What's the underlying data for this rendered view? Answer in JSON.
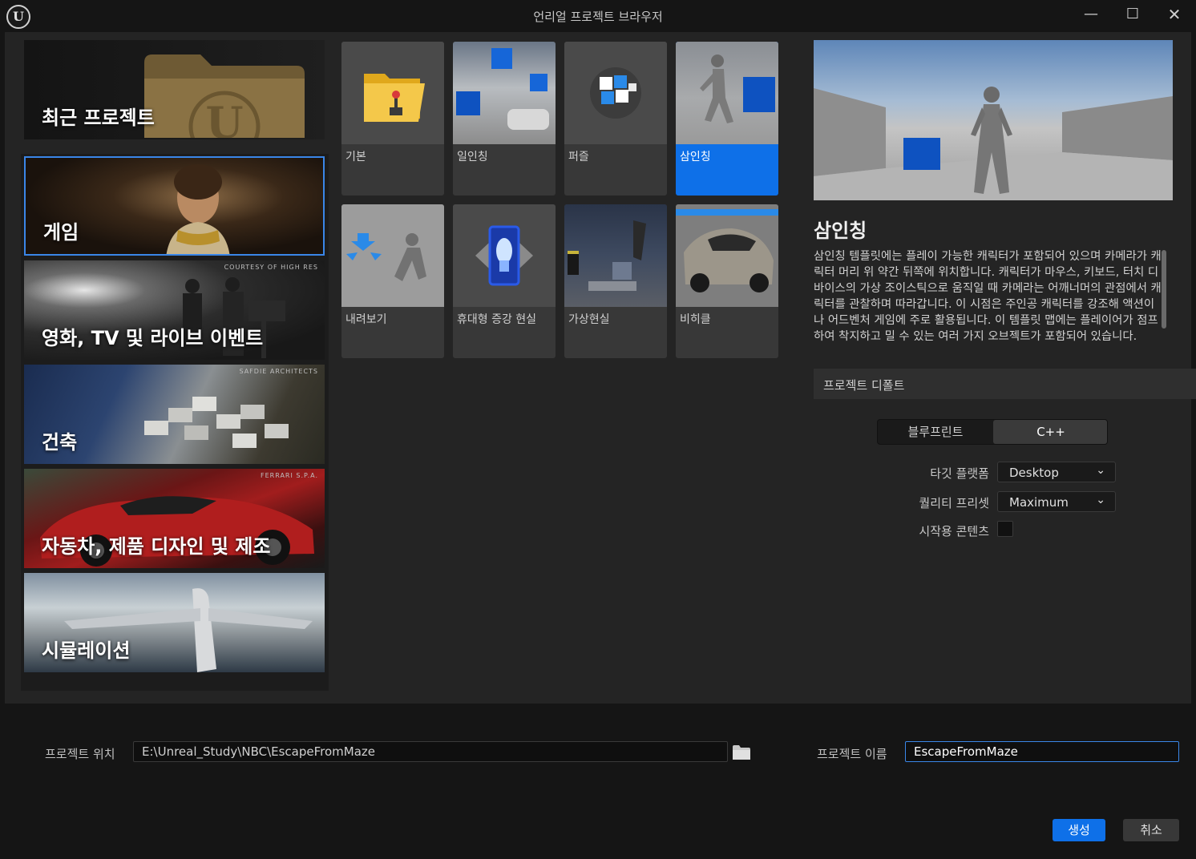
{
  "window": {
    "title": "언리얼 프로젝트 브라우저",
    "logo_text": "U",
    "minimize": "—",
    "maximize": "☐",
    "close": "✕"
  },
  "categories": [
    {
      "label": "최근 프로젝트",
      "credit": ""
    },
    {
      "label": "게임",
      "credit": ""
    },
    {
      "label": "영화, TV 및 라이브 이벤트",
      "credit": "COURTESY OF HIGH RES"
    },
    {
      "label": "건축",
      "credit": "SAFDIE ARCHITECTS"
    },
    {
      "label": "자동차, 제품 디자인 및 제조",
      "credit": "FERRARI S.P.A."
    },
    {
      "label": "시뮬레이션",
      "credit": ""
    }
  ],
  "templates": [
    {
      "label": "기본",
      "selected": false
    },
    {
      "label": "일인칭",
      "selected": false
    },
    {
      "label": "퍼즐",
      "selected": false
    },
    {
      "label": "삼인칭",
      "selected": true
    },
    {
      "label": "내려보기",
      "selected": false
    },
    {
      "label": "휴대형 증강 현실",
      "selected": false
    },
    {
      "label": "가상현실",
      "selected": false
    },
    {
      "label": "비히클",
      "selected": false
    }
  ],
  "details": {
    "title": "삼인칭",
    "description": "삼인칭 템플릿에는 플레이 가능한 캐릭터가 포함되어 있으며 카메라가 캐릭터 머리 위 약간 뒤쪽에 위치합니다. 캐릭터가 마우스, 키보드, 터치 디바이스의 가상 조이스틱으로 움직일 때 카메라는 어깨너머의 관점에서 캐릭터를 관찰하며 따라갑니다. 이 시점은 주인공 캐릭터를 강조해 액션이나 어드벤처 게임에 주로 활용됩니다. 이 템플릿 맵에는 플레이어가 점프하여 착지하고 밀 수 있는 여러 가지 오브젝트가 포함되어 있습니다.",
    "defaults_header": "프로젝트 디폴트",
    "toggle": {
      "blueprint": "블루프린트",
      "cpp": "C++",
      "selected": "cpp"
    },
    "target_platform": {
      "label": "타깃 플랫폼",
      "value": "Desktop"
    },
    "quality_preset": {
      "label": "퀄리티 프리셋",
      "value": "Maximum"
    },
    "starter_content": {
      "label": "시작용 콘텐츠",
      "checked": false
    }
  },
  "project": {
    "location_label": "프로젝트 위치",
    "location_value": "E:\\Unreal_Study\\NBC\\EscapeFromMaze",
    "name_label": "프로젝트 이름",
    "name_value": "EscapeFromMaze"
  },
  "buttons": {
    "create": "생성",
    "cancel": "취소"
  },
  "colors": {
    "accent": "#0e70e8",
    "background": "#242424"
  }
}
